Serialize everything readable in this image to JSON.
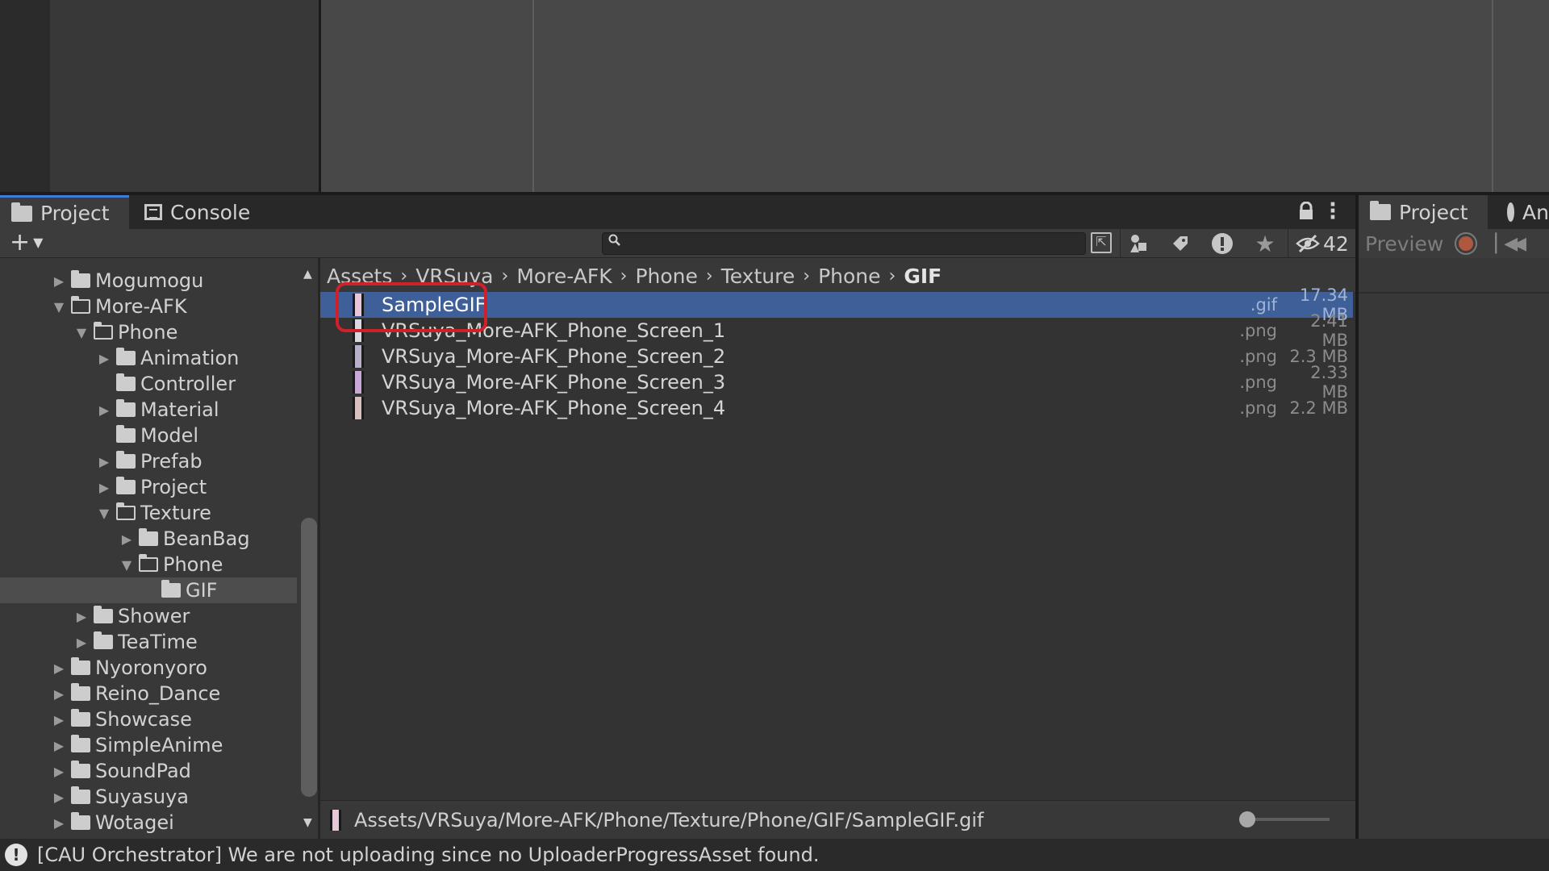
{
  "tabs": {
    "project": "Project",
    "console": "Console"
  },
  "right_panel": {
    "tab_project": "Project",
    "tab_animation": "An",
    "preview": "Preview"
  },
  "toolbar": {
    "add": "+",
    "search_placeholder": "",
    "hidden_count": "42"
  },
  "tree": {
    "items": [
      {
        "label": "Mogumogu",
        "depth": 0,
        "expanded": false
      },
      {
        "label": "More-AFK",
        "depth": 0,
        "expanded": true
      },
      {
        "label": "Phone",
        "depth": 1,
        "expanded": true
      },
      {
        "label": "Animation",
        "depth": 2,
        "expanded": false
      },
      {
        "label": "Controller",
        "depth": 2,
        "leaf": true
      },
      {
        "label": "Material",
        "depth": 2,
        "expanded": false
      },
      {
        "label": "Model",
        "depth": 2,
        "leaf": true
      },
      {
        "label": "Prefab",
        "depth": 2,
        "expanded": false
      },
      {
        "label": "Project",
        "depth": 2,
        "expanded": false
      },
      {
        "label": "Texture",
        "depth": 2,
        "expanded": true
      },
      {
        "label": "BeanBag",
        "depth": 3,
        "expanded": false
      },
      {
        "label": "Phone",
        "depth": 3,
        "expanded": true
      },
      {
        "label": "GIF",
        "depth": 4,
        "leaf": true,
        "selected": true
      },
      {
        "label": "Shower",
        "depth": 1,
        "expanded": false
      },
      {
        "label": "TeaTime",
        "depth": 1,
        "expanded": false
      },
      {
        "label": "Nyoronyoro",
        "depth": 0,
        "expanded": false
      },
      {
        "label": "Reino_Dance",
        "depth": 0,
        "expanded": false
      },
      {
        "label": "Showcase",
        "depth": 0,
        "expanded": false
      },
      {
        "label": "SimpleAnime",
        "depth": 0,
        "expanded": false
      },
      {
        "label": "SoundPad",
        "depth": 0,
        "expanded": false
      },
      {
        "label": "Suyasuya",
        "depth": 0,
        "expanded": false
      },
      {
        "label": "Wotagei",
        "depth": 0,
        "expanded": false
      }
    ]
  },
  "breadcrumb": [
    "Assets",
    "VRSuya",
    "More-AFK",
    "Phone",
    "Texture",
    "Phone",
    "GIF"
  ],
  "files": [
    {
      "name": "SampleGIF",
      "ext": ".gif",
      "size": "17.34 MB",
      "selected": true,
      "thumb": "#e8c8d8"
    },
    {
      "name": "VRSuya_More-AFK_Phone_Screen_1",
      "ext": ".png",
      "size": "2.41 MB",
      "selected": false,
      "thumb": "#d8d8e0"
    },
    {
      "name": "VRSuya_More-AFK_Phone_Screen_2",
      "ext": ".png",
      "size": "2.3 MB",
      "selected": false,
      "thumb": "#b8b0c8"
    },
    {
      "name": "VRSuya_More-AFK_Phone_Screen_3",
      "ext": ".png",
      "size": "2.33 MB",
      "selected": false,
      "thumb": "#c8a8d8"
    },
    {
      "name": "VRSuya_More-AFK_Phone_Screen_4",
      "ext": ".png",
      "size": "2.2 MB",
      "selected": false,
      "thumb": "#d8c0c0"
    }
  ],
  "path_bar": {
    "path": "Assets/VRSuya/More-AFK/Phone/Texture/Phone/GIF/SampleGIF.gif"
  },
  "status": {
    "message": "[CAU Orchestrator] We are not uploading since no UploaderProgressAsset found."
  },
  "colors": {
    "selection": "#3e5f97",
    "highlight": "#d0202a",
    "tab_accent": "#3f7bd8"
  }
}
